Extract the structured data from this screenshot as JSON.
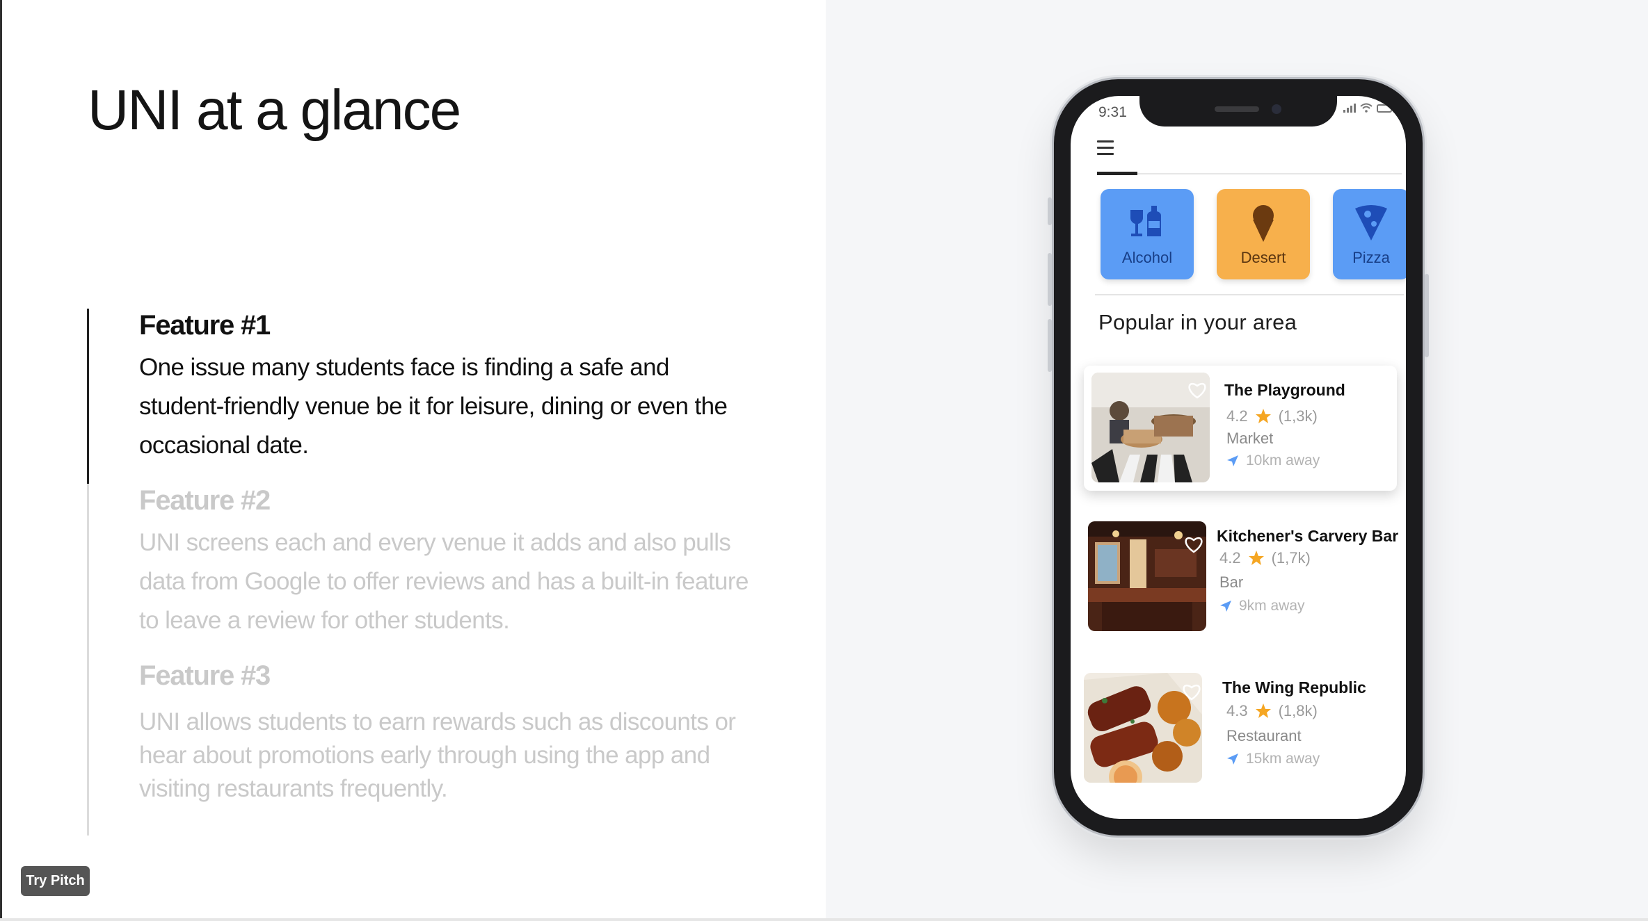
{
  "slide": {
    "title": "UNI at a glance"
  },
  "features": [
    {
      "title": "Feature #1",
      "body": "One issue many students face is finding a safe and student-friendly venue be it for leisure, dining or even the occasional date."
    },
    {
      "title": "Feature #2",
      "body": "UNI screens each and every venue it adds and also pulls data from Google to offer reviews and has a built-in feature to leave a review for other students."
    },
    {
      "title": "Feature #3",
      "body": "UNI allows students to earn rewards such as discounts or hear about promotions early through using the app and visiting restaurants frequently."
    }
  ],
  "badge": {
    "label": "Try Pitch"
  },
  "phone": {
    "status_time": "9:31",
    "categories": [
      {
        "label": "Alcohol",
        "icon": "bottle-glass-icon",
        "color": "#5b9cf5"
      },
      {
        "label": "Desert",
        "icon": "ice-cream-icon",
        "color": "#f7b04c"
      },
      {
        "label": "Pizza",
        "icon": "pizza-icon",
        "color": "#5b9cf5"
      }
    ],
    "section_title": "Popular in your area",
    "venues": [
      {
        "name": "The Playground",
        "rating": "4.2",
        "reviews": "(1,3k)",
        "type": "Market",
        "distance": "10km away"
      },
      {
        "name": "Kitchener's Carvery Bar",
        "rating": "4.2",
        "reviews": "(1,7k)",
        "type": "Bar",
        "distance": "9km away"
      },
      {
        "name": "The Wing Republic",
        "rating": "4.3",
        "reviews": "(1,8k)",
        "type": "Restaurant",
        "distance": "15km away"
      }
    ]
  },
  "colors": {
    "accent_blue": "#5b9cf5",
    "accent_orange": "#f7b04c",
    "star": "#f5a623",
    "right_panel_bg": "#f5f6f8"
  }
}
